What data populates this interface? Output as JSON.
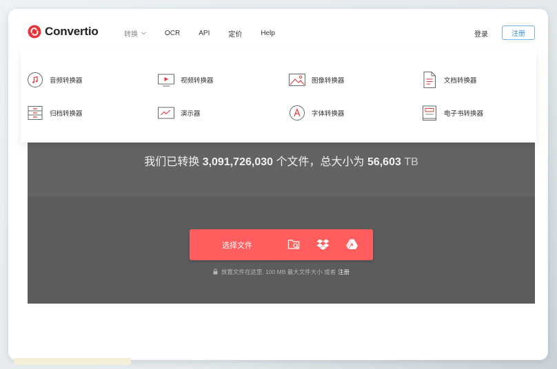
{
  "header": {
    "logo_text": "Convertio",
    "nav": [
      {
        "label": "转换",
        "has_dropdown": true
      },
      {
        "label": "OCR"
      },
      {
        "label": "API"
      },
      {
        "label": "定价"
      },
      {
        "label": "Help"
      }
    ],
    "login_label": "登录",
    "register_label": "注册"
  },
  "dropdown": {
    "items": [
      {
        "label": "音频转换器",
        "icon": "music-note-icon"
      },
      {
        "label": "视频转换器",
        "icon": "video-play-icon"
      },
      {
        "label": "图像转换器",
        "icon": "image-icon"
      },
      {
        "label": "文档转换器",
        "icon": "document-icon"
      },
      {
        "label": "归档转换器",
        "icon": "archive-icon"
      },
      {
        "label": "演示器",
        "icon": "presentation-icon"
      },
      {
        "label": "字体转换器",
        "icon": "font-icon"
      },
      {
        "label": "电子书转换器",
        "icon": "ebook-icon"
      }
    ]
  },
  "hero": {
    "stats_prefix": "我们已转换",
    "files_count": "3,091,726,030",
    "stats_middle": "个文件，总大小为",
    "total_size": "56,603",
    "size_unit": "TB"
  },
  "upload": {
    "choose_label": "选择文件",
    "hint_text": "放置文件在这里. 100 MB 最大文件大小 或者",
    "hint_register": "注册"
  },
  "colors": {
    "accent": "#ff5e5e",
    "hero_bg": "#5f5f5f",
    "link_blue": "#3b8fd6"
  }
}
